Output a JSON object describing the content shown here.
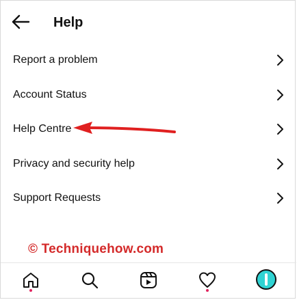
{
  "header": {
    "title": "Help"
  },
  "menu": {
    "items": [
      {
        "label": "Report a problem"
      },
      {
        "label": "Account Status"
      },
      {
        "label": "Help Centre"
      },
      {
        "label": "Privacy and security help"
      },
      {
        "label": "Support Requests"
      }
    ]
  },
  "watermark": {
    "text": "© Techniquehow.com"
  },
  "tabbar": {
    "tabs": [
      {
        "icon": "home-icon"
      },
      {
        "icon": "search-icon"
      },
      {
        "icon": "reels-icon"
      },
      {
        "icon": "heart-icon"
      },
      {
        "icon": "profile-avatar"
      }
    ]
  },
  "colors": {
    "annotation": "#e02020",
    "watermark": "#d42a2a",
    "notification_dot": "#e0245e",
    "avatar": "#2fd3d3"
  }
}
